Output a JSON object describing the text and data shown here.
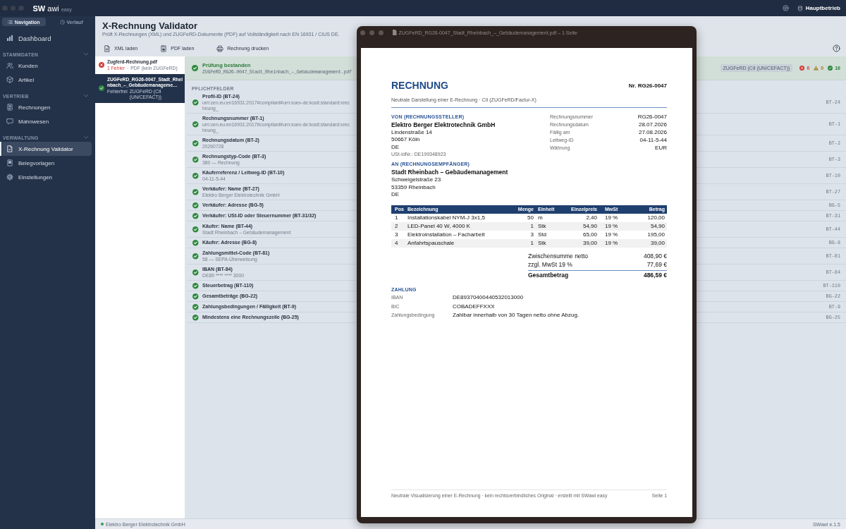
{
  "top_bar": {
    "logo": {
      "mark": "SW",
      "name": "awi",
      "edition": "easy"
    },
    "company": "Hauptbetrieb"
  },
  "sidebar": {
    "tabs": [
      {
        "label": "Navigation",
        "selected": true
      },
      {
        "label": "Verlauf",
        "selected": false
      }
    ],
    "home": {
      "label": "Dashboard",
      "selected": false
    },
    "sections": [
      {
        "title": "STAMMDATEN",
        "expanded": true,
        "items": [
          {
            "label": "Kunden",
            "selected": false
          },
          {
            "label": "Artikel",
            "selected": false
          }
        ]
      },
      {
        "title": "VERTRIEB",
        "expanded": true,
        "items": [
          {
            "label": "Rechnungen",
            "selected": false
          },
          {
            "label": "Mahnwesen",
            "selected": false
          }
        ]
      },
      {
        "title": "VERWALTUNG",
        "expanded": true,
        "items": [
          {
            "label": "X-Rechnung Validator",
            "selected": true
          },
          {
            "label": "Belegvorlagen",
            "selected": false
          },
          {
            "label": "Einstellungen",
            "selected": false
          }
        ]
      }
    ]
  },
  "page": {
    "title": "X-Rechnung Validator",
    "subtitle": "Prüft X-Rechnungen (XML) und ZUGFeRD-Dokumente (PDF) auf Vollständigkeit nach EN 16931 / CIUS DE."
  },
  "toolbar": [
    "XML laden",
    "PDF laden",
    "Rechnung drucken"
  ],
  "files": [
    {
      "name": "Zugferd-Rechnung.pdf",
      "status": "1 Fehler",
      "separator": "·",
      "type": "PDF (kein ZUGFeRD)",
      "valid": false,
      "selected": false
    },
    {
      "name": "ZUGFeRD_RG26-0047_Stadt_Rheinbach_–_Gebäudemanageme…",
      "status": "Fehlerfrei",
      "type": "ZUGFeRD (CII (UN/CEFACT))",
      "valid": true,
      "selected": true
    }
  ],
  "result": {
    "passed": true,
    "title": "Prüfung bestanden",
    "file": "ZUGFeRD_RG26-0047_Stadt_Rheinbach_–_Gebäudemanagement.pdf",
    "format": "ZUGFeRD (CII (UN/CEFACT))",
    "counts": [
      {
        "kind": "error",
        "value": "0"
      },
      {
        "kind": "warning",
        "value": "0"
      },
      {
        "kind": "ok",
        "value": "16"
      }
    ]
  },
  "checks": {
    "title": "PFLICHTFELDER",
    "items": [
      {
        "label": "Profil-ID (BT-24)",
        "value": "urn:cen.eu:en16931:2017#compliant#urn:xoev-de:kosit:standard:xrechnung_",
        "code": "BT-24",
        "ok": true
      },
      {
        "label": "Rechnungsnummer (BT-1)",
        "value": "urn:cen.eu:en16931:2017#compliant#urn:xoev-de:kosit:standard:xrechnung_",
        "code": "BT-1",
        "ok": true
      },
      {
        "label": "Rechnungsdatum (BT-2)",
        "value": "20260728",
        "code": "BT-2",
        "ok": true
      },
      {
        "label": "Rechnungstyp-Code (BT-3)",
        "value": "380 — Rechnung",
        "code": "BT-3",
        "ok": true
      },
      {
        "label": "Käuferreferenz / Leitweg-ID (BT-10)",
        "value": "04-11-5-44",
        "code": "BT-10",
        "ok": true
      },
      {
        "label": "Verkäufer: Name (BT-27)",
        "value": "Elektro Berger Elektrotechnik GmbH",
        "code": "BT-27",
        "ok": true
      },
      {
        "label": "Verkäufer: Adresse (BG-5)",
        "code": "BG-5",
        "ok": true
      },
      {
        "label": "Verkäufer: USt-ID oder Steuernummer (BT-31/32)",
        "code": "BT-31",
        "ok": true
      },
      {
        "label": "Käufer: Name (BT-44)",
        "value": "Stadt Rheinbach – Gebäudemanagement",
        "code": "BT-44",
        "ok": true
      },
      {
        "label": "Käufer: Adresse (BG-8)",
        "code": "BG-8",
        "ok": true
      },
      {
        "label": "Zahlungsmittel-Code (BT-81)",
        "value": "58 — SEPA-Überweisung",
        "code": "BT-81",
        "ok": true
      },
      {
        "label": "IBAN (BT-84)",
        "value": "DE89 **** **** 3000",
        "code": "BT-84",
        "ok": true
      },
      {
        "label": "Steuerbetrag (BT-110)",
        "code": "BT-110",
        "ok": true
      },
      {
        "label": "Gesamtbeträge (BG-22)",
        "code": "BG-22",
        "ok": true
      },
      {
        "label": "Zahlungsbedingungen / Fälligkeit (BT-9)",
        "code": "BT-9",
        "ok": true
      },
      {
        "label": "Mindestens eine Rechnungszeile (BG-25)",
        "code": "BG-25",
        "ok": true
      }
    ]
  },
  "status_bar": {
    "connected": true,
    "company": "Elektro Berger Elektrotechnik GmbH",
    "version": "SWawi e.1.5"
  },
  "pdf_viewer": {
    "title": "ZUGFeRD_RG26-0047_Stadt_Rheinbach_–_Gebäudemanagement.pdf – 1 Seite",
    "document": {
      "heading": "RECHNUNG",
      "number": "Nr. RG26-0047",
      "subheading": "Neutrale Darstellung einer E-Rechnung · CII (ZUGFeRD/Factur-X)",
      "seller": {
        "label": "VON (RECHNUNGSSTELLER)",
        "name": "Elektro Berger Elektrotechnik GmbH",
        "lines": [
          "Lindenstraße 14",
          "50667 Köln",
          "DE"
        ],
        "vat": "USt-IdNr.: DE199348923"
      },
      "meta": [
        {
          "label": "Rechnungsnummer",
          "value": "RG26-0047"
        },
        {
          "label": "Rechnungsdatum",
          "value": "28.07.2026"
        },
        {
          "label": "Fällig am",
          "value": "27.08.2026"
        },
        {
          "label": "Leitweg-ID",
          "value": "04-11-5-44"
        },
        {
          "label": "Währung",
          "value": "EUR"
        }
      ],
      "buyer": {
        "label": "AN (RECHNUNGSEMPFÄNGER)",
        "name": "Stadt Rheinbach – Gebäudemanagement",
        "lines": [
          "Schweigelstraße 23",
          "53359 Rheinbach",
          "DE"
        ]
      },
      "table": {
        "columns": [
          "Pos",
          "Bezeichnung",
          "Menge",
          "Einheit",
          "Einzelpreis",
          "MwSt",
          "Betrag"
        ],
        "rows": [
          [
            "1",
            "Installationskabel NYM-J 3x1,5",
            "50",
            "m",
            "2,40",
            "19 %",
            "120,00"
          ],
          [
            "2",
            "LED-Panel 40 W, 4000 K",
            "1",
            "Stk",
            "54,90",
            "19 %",
            "54,90"
          ],
          [
            "3",
            "Elektroinstallation – Facharbeit",
            "3",
            "Std",
            "65,00",
            "19 %",
            "195,00"
          ],
          [
            "4",
            "Anfahrtspauschale",
            "1",
            "Stk",
            "39,00",
            "19 %",
            "39,00"
          ]
        ]
      },
      "totals": [
        {
          "kind": "line",
          "label": "Zwischensumme netto",
          "value": "408,90 €"
        },
        {
          "kind": "line",
          "label": "zzgl. MwSt 19 %",
          "value": "77,69 €"
        },
        {
          "kind": "total",
          "label": "Gesamtbetrag",
          "value": "486,59 €"
        }
      ],
      "payment": {
        "title": "ZAHLUNG",
        "rows": [
          {
            "label": "IBAN",
            "value": "DE89370400440532013000"
          },
          {
            "label": "BIC",
            "value": "COBADEFFXXX"
          },
          {
            "label": "Zahlungsbedingung",
            "value": "Zahlbar innerhalb von 30 Tagen netto ohne Abzug."
          }
        ]
      },
      "footer": {
        "note": "Neutrale Visualisierung einer E-Rechnung · kein rechtsverbindliches Original · erstellt mit SWawi easy",
        "page": "Seite 1"
      }
    }
  }
}
